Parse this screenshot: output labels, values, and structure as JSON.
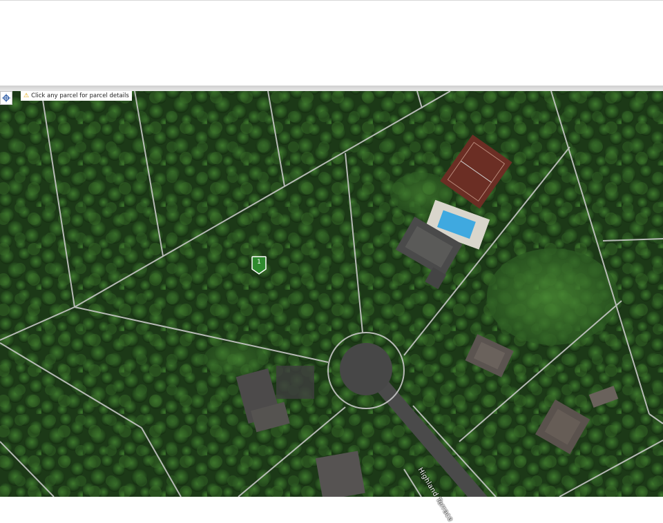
{
  "map": {
    "hint_text": "Click any parcel for parcel details",
    "road_label": "Highland Terrace",
    "marker_label": "1",
    "colors": {
      "parcel_lines": "#c8c8c8",
      "marker": "#2e8b2e",
      "forest": "#1f3f1a",
      "pool": "#3fa9e0",
      "court": "#6b2e24"
    },
    "icons": {
      "locate": "crosshair-icon",
      "warning": "warning-icon"
    }
  }
}
